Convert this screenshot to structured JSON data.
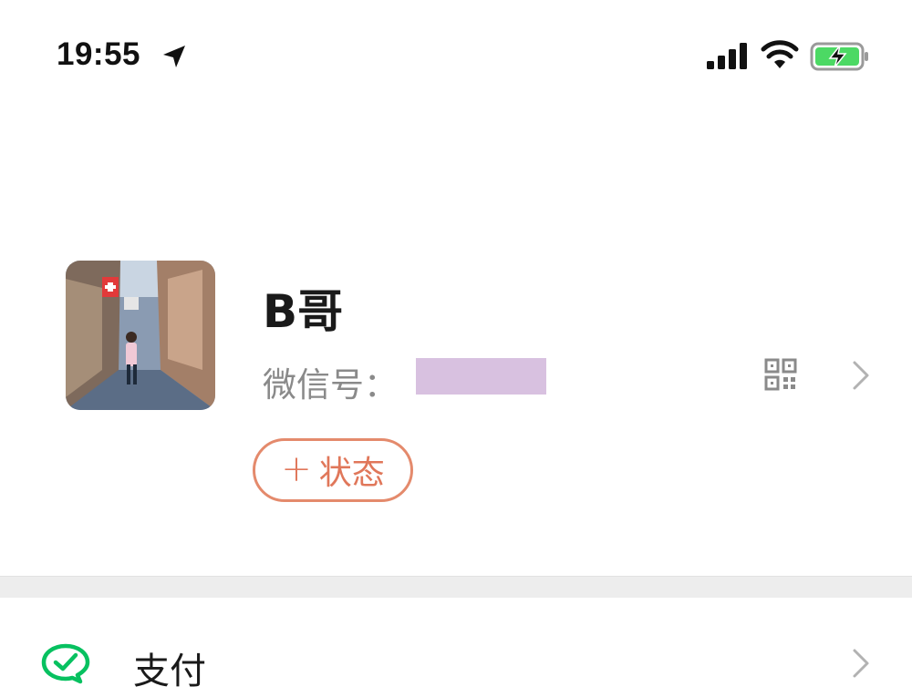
{
  "status_bar": {
    "time": "19:55",
    "icons": [
      "location-arrow-icon",
      "cellular-signal-icon",
      "wifi-icon",
      "battery-charging-icon"
    ],
    "battery_color": "#4cd964"
  },
  "profile": {
    "nickname": "B哥",
    "wechat_id_label": "微信号：",
    "wechat_id_redaction_color": "#d8c1e0",
    "status_button_plus": "+",
    "status_button_label": "状态",
    "accent_color": "#e0775a"
  },
  "menu": {
    "items": [
      {
        "label": "支付",
        "icon": "wechat-pay-icon",
        "icon_color": "#07c160"
      }
    ]
  }
}
